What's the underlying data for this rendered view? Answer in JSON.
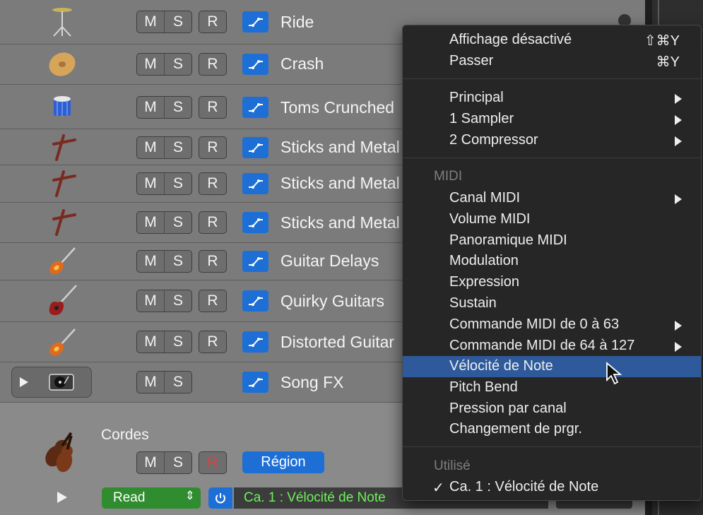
{
  "tracks": [
    {
      "name": "Ride",
      "icon": "cymbal-stand-icon",
      "mute": "M",
      "solo": "S",
      "record": "R"
    },
    {
      "name": "Crash",
      "icon": "crash-cymbal-icon",
      "mute": "M",
      "solo": "S",
      "record": "R"
    },
    {
      "name": "Toms Crunched",
      "icon": "tom-drum-icon",
      "mute": "M",
      "solo": "S",
      "record": "R"
    },
    {
      "name": "Sticks and Metal",
      "icon": "drumsticks-icon",
      "mute": "M",
      "solo": "S",
      "record": "R"
    },
    {
      "name": "Sticks and Metal",
      "icon": "drumsticks-icon",
      "mute": "M",
      "solo": "S",
      "record": "R"
    },
    {
      "name": "Sticks and Metal",
      "icon": "drumsticks-icon",
      "mute": "M",
      "solo": "S",
      "record": "R"
    },
    {
      "name": "Guitar Delays",
      "icon": "electric-guitar-icon",
      "mute": "M",
      "solo": "S",
      "record": "R"
    },
    {
      "name": "Quirky Guitars",
      "icon": "sg-guitar-icon",
      "mute": "M",
      "solo": "S",
      "record": "R"
    },
    {
      "name": "Distorted Guitar",
      "icon": "electric-guitar-icon",
      "mute": "M",
      "solo": "S",
      "record": "R"
    },
    {
      "name": "Song FX",
      "icon": "turntable-icon",
      "mute": "M",
      "solo": "S"
    }
  ],
  "inspector": {
    "track_name": "Cordes",
    "mute": "M",
    "solo": "S",
    "record": "R",
    "region_button": "Région",
    "automation_mode": "Read",
    "automation_parameter": "Ca. 1 : Vélocité de Note"
  },
  "menu": {
    "top": [
      {
        "label": "Affichage désactivé",
        "shortcut": "⇧⌘Y"
      },
      {
        "label": "Passer",
        "shortcut": "⌘Y"
      }
    ],
    "plugins": [
      {
        "label": "Principal",
        "submenu": true
      },
      {
        "label": "1 Sampler",
        "submenu": true
      },
      {
        "label": "2 Compressor",
        "submenu": true
      }
    ],
    "midi_header": "MIDI",
    "midi": [
      {
        "label": "Canal MIDI",
        "submenu": true
      },
      {
        "label": "Volume MIDI"
      },
      {
        "label": "Panoramique MIDI"
      },
      {
        "label": "Modulation"
      },
      {
        "label": "Expression"
      },
      {
        "label": "Sustain"
      },
      {
        "label": "Commande MIDI de 0 à 63",
        "submenu": true
      },
      {
        "label": "Commande MIDI de 64 à 127",
        "submenu": true
      },
      {
        "label": "Vélocité de Note",
        "highlighted": true
      },
      {
        "label": "Pitch Bend"
      },
      {
        "label": "Pression par canal"
      },
      {
        "label": "Changement de prgr."
      }
    ],
    "used_header": "Utilisé",
    "used": [
      {
        "label": "Ca. 1 : Vélocité de Note",
        "checkmark": "✓"
      }
    ]
  },
  "colors": {
    "track_bg": "#7b7b7b",
    "menu_bg": "#262626",
    "highlight": "#2e5a9b",
    "automation_blue": "#1d6fd6",
    "read_green": "#2f8c2f",
    "param_text_green": "#6cf25a",
    "record_red": "#e04040"
  }
}
